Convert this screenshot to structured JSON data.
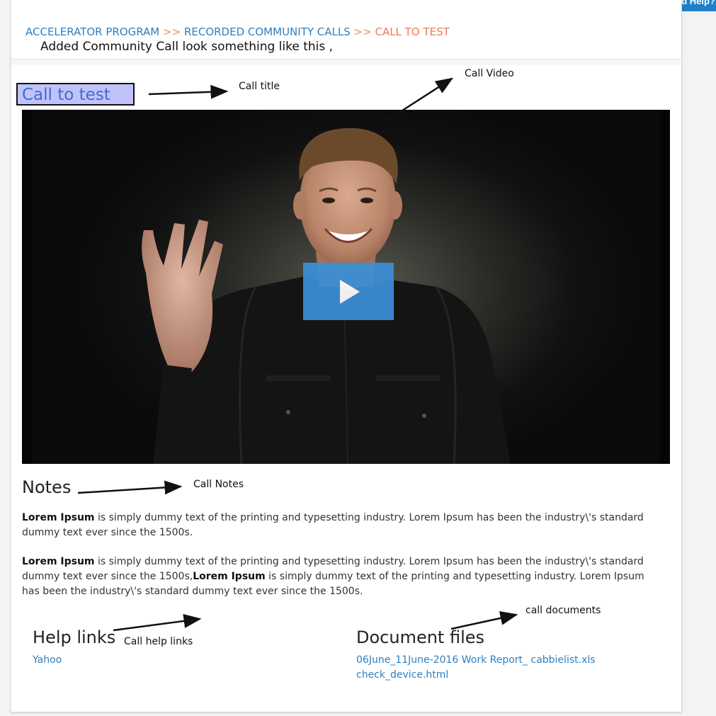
{
  "header": {
    "help_button": "Do you need Help?",
    "breadcrumb": {
      "items": [
        "ACCELERATOR PROGRAM",
        "RECORDED COMMUNITY CALLS"
      ],
      "separator": ">>",
      "current": "CALL TO TEST"
    },
    "subtitle": "Added Community Call look something like this ,"
  },
  "call": {
    "title": "Call to test"
  },
  "annotations": {
    "call_title": "Call title",
    "call_video": "Call Video",
    "call_notes": "Call Notes",
    "call_help_links": "Call help links",
    "call_documents": "call documents"
  },
  "notes": {
    "heading": "Notes",
    "para1": {
      "bold": "Lorem Ipsum",
      "text": " is simply dummy text of the printing and typesetting industry. Lorem Ipsum has been the industry\\'s standard dummy text ever since the 1500s."
    },
    "para2": {
      "bold1": "Lorem Ipsum",
      "text1": " is simply dummy text of the printing and typesetting industry. Lorem Ipsum has been the industry\\'s standard dummy text ever since the 1500s,",
      "bold2": "Lorem Ipsum",
      "text2": " is simply dummy text of the printing and typesetting industry. Lorem Ipsum has been the industry\\'s standard dummy text ever since the 1500s."
    }
  },
  "help_links": {
    "heading": "Help links",
    "items": [
      "Yahoo"
    ]
  },
  "documents": {
    "heading": "Document files",
    "items": [
      "06June_11June-2016 Work Report_ cabbielist.xls",
      "check_device.html"
    ]
  },
  "colors": {
    "link": "#2f7fbf",
    "breadcrumb_current": "#ee7a52",
    "title_highlight": "#c2c2fb",
    "play_button": "#3b8fd6",
    "help_button": "#1f7fc9"
  },
  "icons": [
    "play-icon",
    "arrow-icon"
  ]
}
